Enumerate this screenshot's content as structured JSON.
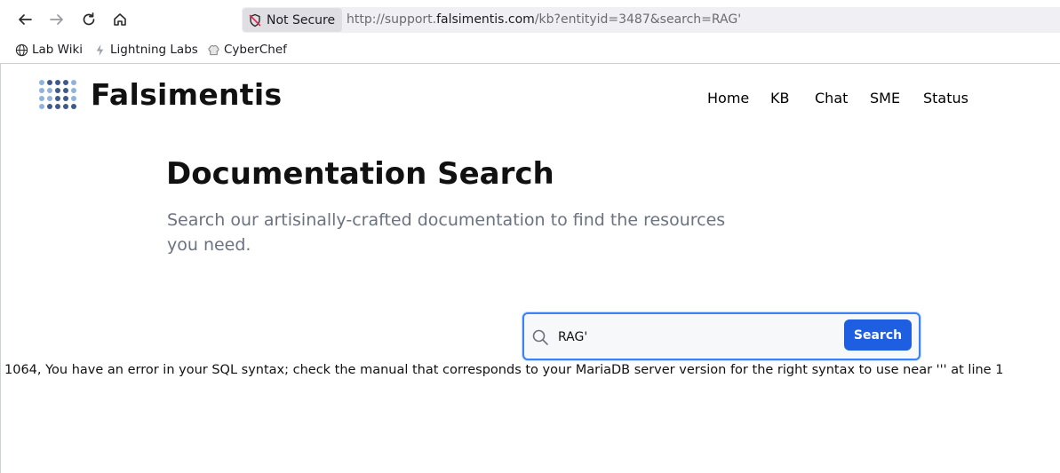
{
  "browser": {
    "security_label": "Not Secure",
    "url_prefix": "http://support.",
    "url_host": "falsimentis.com",
    "url_suffix": "/kb?entityid=3487&search=RAG'",
    "icons": [
      "back-icon",
      "forward-icon",
      "reload-icon",
      "home-icon",
      "not-secure-shield-icon"
    ]
  },
  "bookmarks": [
    {
      "label": "Lab Wiki",
      "icon": "globe-icon"
    },
    {
      "label": "Lightning Labs",
      "icon": "lightning-labs-icon"
    },
    {
      "label": "CyberChef",
      "icon": "chef-hat-icon"
    }
  ],
  "site": {
    "brand": "Falsimentis",
    "nav": [
      "Home",
      "KB",
      "Chat",
      "SME",
      "Status"
    ]
  },
  "hero": {
    "title": "Documentation Search",
    "subtitle": "Search our artisinally-crafted documentation to find the resources you need."
  },
  "search": {
    "value": "RAG'",
    "button_label": "Search"
  },
  "error_message": "1064, You have an error in your SQL syntax; check the manual that corresponds to your MariaDB server version for the right syntax to use near ''' at line 1",
  "colors": {
    "accent": "#1d5fe0",
    "focus_ring": "#3b82f6",
    "logo_dark": "#3d5a8a",
    "logo_light": "#8fb3dc"
  }
}
